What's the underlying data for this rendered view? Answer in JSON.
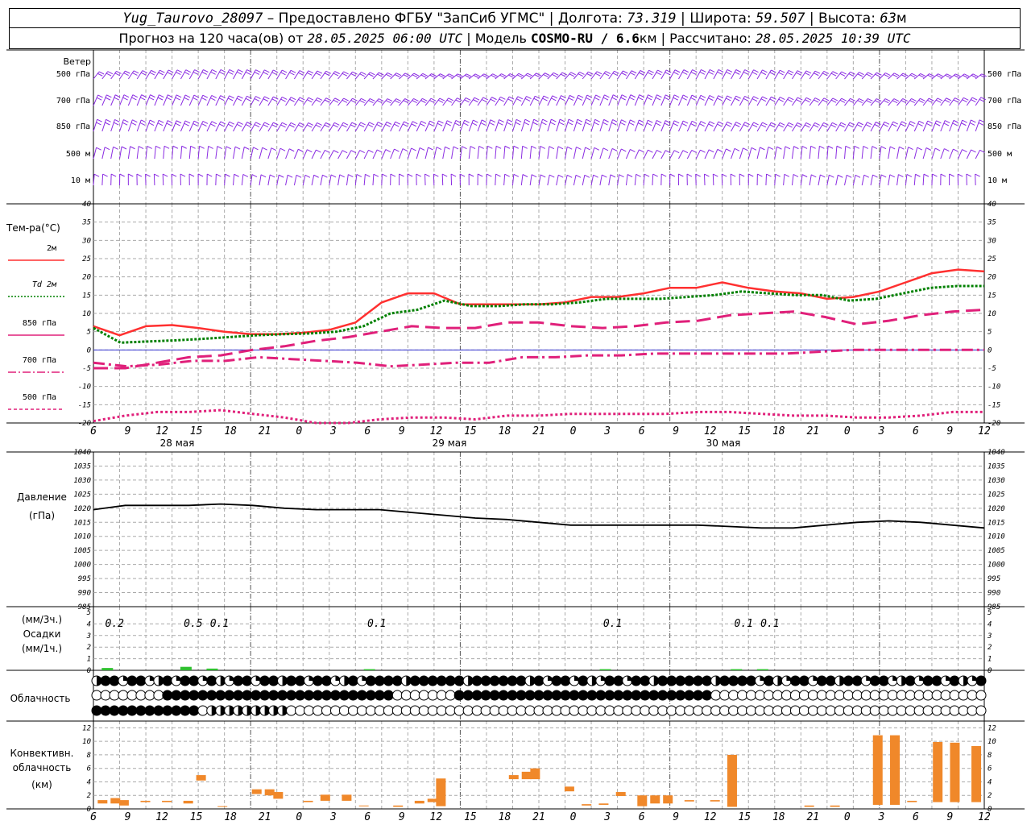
{
  "header": {
    "station": "Yug_Taurovo_28097",
    "sep1": " – ",
    "provider": "Предоставлено ФГБУ \"ЗапСиб УГМС\"",
    "lon_label": "Долгота:",
    "lon": "73.319",
    "lat_label": "Широта:",
    "lat": "59.507",
    "alt_label": "Высота:",
    "alt": "63",
    "alt_unit": "м",
    "forecast_label": "Прогноз на 120 часа(ов) от",
    "forecast_from": "28.05.2025 06:00 UTC",
    "model_label": "Модель",
    "model": "COSMO-RU / 6.6",
    "model_unit": "км",
    "calc_label": "Рассчитано:",
    "calc_time": "28.05.2025 10:39 UTC"
  },
  "panels": {
    "wind": {
      "title": "Ветер",
      "levels": [
        "500 гПа",
        "700 гПа",
        "850 гПа",
        "500 м",
        "10 м"
      ]
    },
    "temp": {
      "title": "Тем-ра(°С)",
      "legend": [
        {
          "label": "2м",
          "color": "#ff3030",
          "style": "solid"
        },
        {
          "label": "Td 2м",
          "color": "#008000",
          "style": "dotted"
        },
        {
          "label": "850 гПа",
          "color": "#e0207a",
          "style": "solid"
        },
        {
          "label": "700 гПа",
          "color": "#e0207a",
          "style": "dashdot"
        },
        {
          "label": "500 гПа",
          "color": "#e0207a",
          "style": "dashed"
        }
      ]
    },
    "pressure": {
      "title": "Давление",
      "unit": "(гПа)"
    },
    "precip": {
      "unit1": "(мм/3ч.)",
      "title": "Осадки",
      "unit2": "(мм/1ч.)"
    },
    "cloud": {
      "title": "Облачность"
    },
    "conv": {
      "title1": "Конвективн.",
      "title2": "облачность",
      "unit": "(км)"
    }
  },
  "time_axis": {
    "hour_labels": [
      "6",
      "9",
      "12",
      "15",
      "18",
      "21",
      "0",
      "3",
      "6",
      "9",
      "12",
      "15",
      "18",
      "21",
      "0",
      "3",
      "6",
      "9",
      "12",
      "15",
      "18",
      "21",
      "0",
      "3",
      "6",
      "9",
      "12"
    ],
    "dates": [
      "28 мая",
      "29 мая",
      "30 мая"
    ]
  },
  "chart_data": [
    {
      "type": "line",
      "title": "Тем-ра(°С)",
      "x_hours": [
        0,
        3,
        6,
        9,
        12,
        15,
        18,
        21,
        24,
        27,
        30,
        33,
        36,
        39,
        42,
        45,
        48,
        51,
        54,
        57,
        60,
        63,
        66,
        69,
        72,
        75,
        78,
        81,
        84,
        87,
        90,
        93,
        96,
        99,
        102,
        105,
        108,
        111,
        114,
        117,
        120
      ],
      "ylim": [
        -20,
        40
      ],
      "yticks": [
        -20,
        -15,
        -10,
        -5,
        0,
        5,
        10,
        15,
        20,
        25,
        30,
        35,
        40
      ],
      "series": [
        {
          "name": "2м",
          "values": [
            6.5,
            4,
            6.5,
            6.8,
            6,
            5,
            4.3,
            4.3,
            4.7,
            5.5,
            7.5,
            13,
            15.5,
            15.5,
            12.5,
            12.5,
            12.5,
            12.5,
            13,
            14.5,
            14.5,
            15.5,
            17,
            17,
            18.5,
            17,
            16,
            15.5,
            14,
            14.5,
            16,
            18.5,
            21,
            22,
            21.5
          ]
        },
        {
          "name": "Td 2м",
          "values": [
            6,
            2,
            2.3,
            2.6,
            3,
            3.5,
            4,
            4.3,
            4.5,
            5,
            6.5,
            10,
            11,
            13.5,
            12,
            12,
            12.5,
            12.5,
            13,
            14,
            14,
            14,
            14.5,
            15,
            16,
            15.5,
            15,
            15,
            13.5,
            14,
            15.5,
            17,
            17.5,
            17.5
          ]
        },
        {
          "name": "850 гПа",
          "values": [
            -5,
            -5,
            -3.5,
            -2,
            -1.5,
            0,
            1,
            2.5,
            3.5,
            5,
            6.5,
            6,
            6,
            7.5,
            7.5,
            6.5,
            6,
            6.5,
            7.5,
            8,
            9.5,
            10,
            10.5,
            9,
            7,
            8,
            9.5,
            10.5,
            11
          ]
        },
        {
          "name": "700 гПа",
          "values": [
            -3.5,
            -4.5,
            -4,
            -3,
            -3,
            -2,
            -2.5,
            -3,
            -3.5,
            -4.5,
            -4,
            -3.5,
            -3.5,
            -2,
            -2,
            -1.5,
            -1.5,
            -1,
            -1,
            -1,
            -1,
            -1,
            -0.5,
            0,
            0,
            0,
            0,
            0
          ]
        },
        {
          "name": "500 гПа",
          "values": [
            -19.5,
            -18,
            -17,
            -17,
            -16.5,
            -17.5,
            -18.5,
            -20,
            -20,
            -19,
            -18.5,
            -18.5,
            -19,
            -18,
            -18,
            -17.5,
            -17.5,
            -17.5,
            -17.5,
            -17,
            -17,
            -17.5,
            -18,
            -18,
            -18.5,
            -18.5,
            -18,
            -17,
            -17
          ]
        }
      ]
    },
    {
      "type": "line",
      "title": "Давление",
      "ylabel": "(гПа)",
      "ylim": [
        985,
        1040
      ],
      "yticks": [
        985,
        990,
        995,
        1000,
        1005,
        1010,
        1015,
        1020,
        1025,
        1030,
        1035,
        1040
      ],
      "series": [
        {
          "name": "",
          "values": [
            1019.5,
            1021,
            1021,
            1021,
            1021.5,
            1021,
            1020,
            1019.5,
            1019.5,
            1019.5,
            1018.5,
            1017.5,
            1016.5,
            1016,
            1015,
            1014,
            1014,
            1014,
            1014,
            1014,
            1013.5,
            1013,
            1013,
            1014,
            1015,
            1015.5,
            1015,
            1014,
            1013
          ]
        }
      ]
    },
    {
      "type": "bar",
      "title": "Осадки",
      "ylim": [
        0,
        5
      ],
      "yticks": [
        0,
        1,
        2,
        3,
        4,
        5
      ],
      "labels": [
        {
          "hour": 1.5,
          "text": "0.2"
        },
        {
          "hour": 10.5,
          "text": "0.5"
        },
        {
          "hour": 13.5,
          "text": "0.1"
        },
        {
          "hour": 31.5,
          "text": "0.1"
        },
        {
          "hour": 58.5,
          "text": "0.1"
        },
        {
          "hour": 73.5,
          "text": "0.1"
        },
        {
          "hour": 76.5,
          "text": "0.1"
        }
      ],
      "bars": [
        {
          "hour": 1.5,
          "value": 0.2
        },
        {
          "hour": 10.5,
          "value": 0.3
        },
        {
          "hour": 13.5,
          "value": 0.15
        },
        {
          "hour": 31.5,
          "value": 0.1
        },
        {
          "hour": 58.5,
          "value": 0.1
        },
        {
          "hour": 73.5,
          "value": 0.1
        },
        {
          "hour": 76.5,
          "value": 0.1
        }
      ]
    },
    {
      "type": "bar",
      "title": "Конвективн. облачность",
      "ylabel": "(км)",
      "ylim": [
        0,
        13
      ],
      "yticks": [
        0,
        2,
        4,
        6,
        8,
        10,
        12
      ],
      "color": "#f0882a",
      "bars": [
        {
          "hour": 0.5,
          "bottom": 0.8,
          "top": 1.3
        },
        {
          "hour": 2,
          "bottom": 0.8,
          "top": 1.6
        },
        {
          "hour": 3,
          "bottom": 0.5,
          "top": 1.3
        },
        {
          "hour": 5.5,
          "bottom": 1.0,
          "top": 1.2
        },
        {
          "hour": 8,
          "bottom": 1.0,
          "top": 1.2
        },
        {
          "hour": 10.5,
          "bottom": 0.8,
          "top": 1.2
        },
        {
          "hour": 12,
          "bottom": 4.2,
          "top": 5.0
        },
        {
          "hour": 14.5,
          "bottom": 0.3,
          "top": 0.4
        },
        {
          "hour": 18.5,
          "bottom": 2.2,
          "top": 2.9
        },
        {
          "hour": 20,
          "bottom": 2.0,
          "top": 2.9
        },
        {
          "hour": 21,
          "bottom": 1.5,
          "top": 2.5
        },
        {
          "hour": 24.5,
          "bottom": 1.0,
          "top": 1.2
        },
        {
          "hour": 26.5,
          "bottom": 1.2,
          "top": 2.1
        },
        {
          "hour": 29,
          "bottom": 1.2,
          "top": 2.1
        },
        {
          "hour": 31,
          "bottom": 0.4,
          "top": 0.5
        },
        {
          "hour": 35,
          "bottom": 0.3,
          "top": 0.5
        },
        {
          "hour": 37.5,
          "bottom": 0.8,
          "top": 1.2
        },
        {
          "hour": 39,
          "bottom": 1.0,
          "top": 1.5
        },
        {
          "hour": 40,
          "bottom": 0.4,
          "top": 4.5
        },
        {
          "hour": 48.5,
          "bottom": 4.4,
          "top": 5.0
        },
        {
          "hour": 50,
          "bottom": 4.4,
          "top": 5.5
        },
        {
          "hour": 51,
          "bottom": 4.4,
          "top": 6.0
        },
        {
          "hour": 55,
          "bottom": 2.6,
          "top": 3.3
        },
        {
          "hour": 57,
          "bottom": 0.5,
          "top": 0.7
        },
        {
          "hour": 59,
          "bottom": 0.6,
          "top": 0.8
        },
        {
          "hour": 61,
          "bottom": 1.9,
          "top": 2.5
        },
        {
          "hour": 63.5,
          "bottom": 0.4,
          "top": 2.0
        },
        {
          "hour": 65,
          "bottom": 0.8,
          "top": 2.0
        },
        {
          "hour": 66.5,
          "bottom": 0.8,
          "top": 2.0
        },
        {
          "hour": 69,
          "bottom": 1.1,
          "top": 1.3
        },
        {
          "hour": 72,
          "bottom": 1.1,
          "top": 1.3
        },
        {
          "hour": 74,
          "bottom": 0.3,
          "top": 8.0
        },
        {
          "hour": 83,
          "bottom": 0.3,
          "top": 0.5
        },
        {
          "hour": 86,
          "bottom": 0.3,
          "top": 0.5
        },
        {
          "hour": 91,
          "bottom": 0.6,
          "top": 10.9
        },
        {
          "hour": 93,
          "bottom": 0.6,
          "top": 10.9
        },
        {
          "hour": 95,
          "bottom": 1.0,
          "top": 1.2
        },
        {
          "hour": 98,
          "bottom": 1.0,
          "top": 9.9
        },
        {
          "hour": 100,
          "bottom": 1.0,
          "top": 9.8
        },
        {
          "hour": 102.5,
          "bottom": 1.0,
          "top": 9.3
        }
      ]
    }
  ]
}
